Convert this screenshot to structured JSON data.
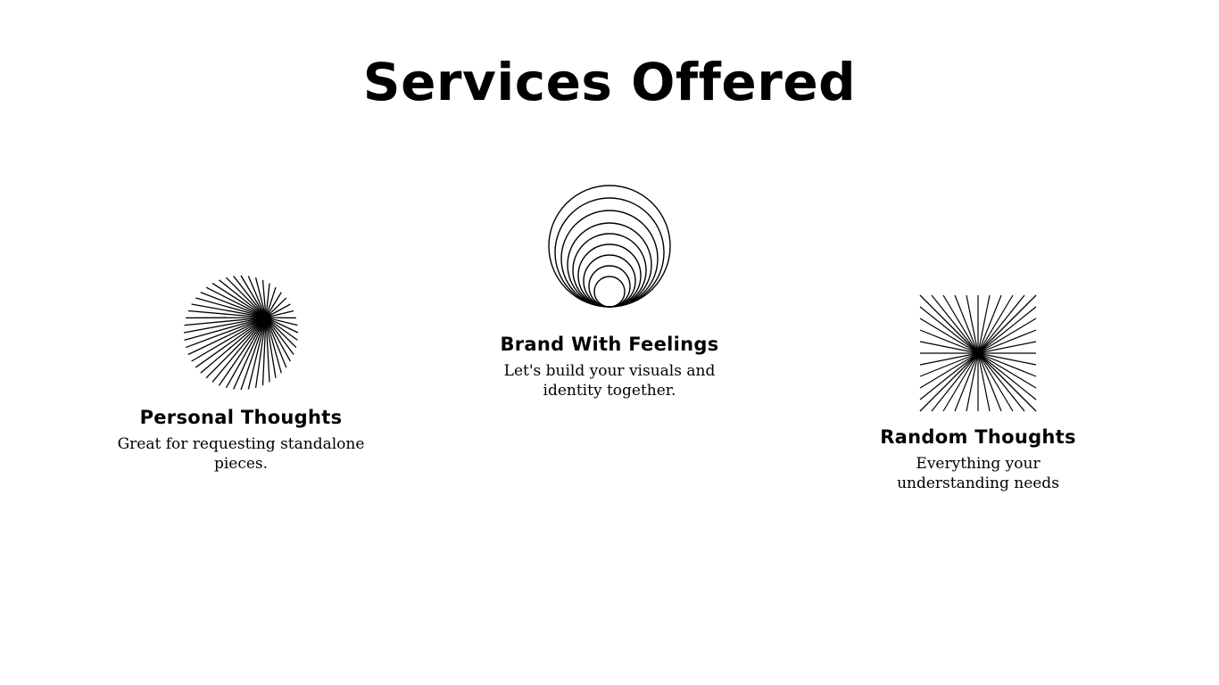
{
  "header": {
    "title": "Services Offered"
  },
  "services": [
    {
      "title": "Personal Thoughts",
      "description": "Great for requesting standalone pieces.",
      "icon": "radial-burst-icon"
    },
    {
      "title": "Brand With Feelings",
      "description": "Let's build your visuals and identity together.",
      "icon": "concentric-circles-icon"
    },
    {
      "title": "Random Thoughts",
      "description": "Everything your understanding needs",
      "icon": "square-starburst-icon"
    }
  ],
  "colors": {
    "background": "#ffffff",
    "text": "#000000"
  }
}
